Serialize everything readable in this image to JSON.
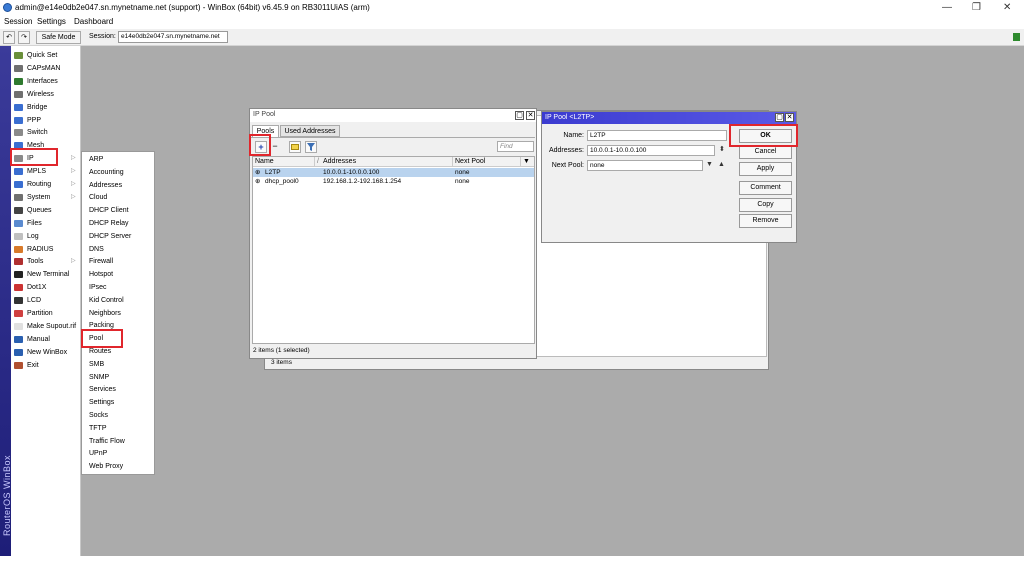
{
  "window": {
    "title": "admin@e14e0db2e047.sn.mynetname.net (support) - WinBox (64bit) v6.45.9 on RB3011UiAS (arm)",
    "controls": {
      "minimize": "—",
      "maximize": "❐",
      "close": "✕"
    }
  },
  "menubar": [
    "Session",
    "Settings",
    "Dashboard"
  ],
  "toolbar": {
    "undo": "↶",
    "redo": "↷",
    "safe_mode": "Safe Mode",
    "session_label": "Session:",
    "session_value": "e14e0db2e047.sn.mynetname.net"
  },
  "sidebar": {
    "brand": "RouterOS WinBox",
    "items": [
      {
        "label": "Quick Set",
        "icon": "quickset-icon",
        "color": "#6a8f3a"
      },
      {
        "label": "CAPsMAN",
        "icon": "antenna-icon",
        "color": "#707070"
      },
      {
        "label": "Interfaces",
        "icon": "interfaces-icon",
        "color": "#2f7a2f"
      },
      {
        "label": "Wireless",
        "icon": "antenna-icon",
        "color": "#707070"
      },
      {
        "label": "Bridge",
        "icon": "bridge-icon",
        "color": "#3a6ed1"
      },
      {
        "label": "PPP",
        "icon": "ppp-icon",
        "color": "#3a6ed1"
      },
      {
        "label": "Switch",
        "icon": "switch-icon",
        "color": "#8a8a8a"
      },
      {
        "label": "Mesh",
        "icon": "mesh-icon",
        "color": "#3a6ed1"
      },
      {
        "label": "IP",
        "icon": "ip-icon",
        "color": "#8a8a8a",
        "arrow": "▷"
      },
      {
        "label": "MPLS",
        "icon": "mpls-icon",
        "color": "#3a6ed1",
        "arrow": "▷"
      },
      {
        "label": "Routing",
        "icon": "routing-icon",
        "color": "#3a6ed1",
        "arrow": "▷"
      },
      {
        "label": "System",
        "icon": "gear-icon",
        "color": "#707070",
        "arrow": "▷"
      },
      {
        "label": "Queues",
        "icon": "queues-icon",
        "color": "#444444"
      },
      {
        "label": "Files",
        "icon": "files-icon",
        "color": "#5b8bd0"
      },
      {
        "label": "Log",
        "icon": "log-icon",
        "color": "#c0c0c0"
      },
      {
        "label": "RADIUS",
        "icon": "radius-icon",
        "color": "#d87a2a"
      },
      {
        "label": "Tools",
        "icon": "tools-icon",
        "color": "#b03030",
        "arrow": "▷"
      },
      {
        "label": "New Terminal",
        "icon": "terminal-icon",
        "color": "#222222"
      },
      {
        "label": "Dot1X",
        "icon": "dot1x-icon",
        "color": "#cc3333"
      },
      {
        "label": "LCD",
        "icon": "lcd-icon",
        "color": "#333333"
      },
      {
        "label": "Partition",
        "icon": "partition-icon",
        "color": "#d04040"
      },
      {
        "label": "Make Supout.rif",
        "icon": "supout-icon",
        "color": "#e0e0e0"
      },
      {
        "label": "Manual",
        "icon": "manual-icon",
        "color": "#2a5fb0"
      },
      {
        "label": "New WinBox",
        "icon": "winbox-icon",
        "color": "#2a5fb0"
      },
      {
        "label": "Exit",
        "icon": "exit-icon",
        "color": "#b05030"
      }
    ]
  },
  "ip_submenu": [
    "ARP",
    "Accounting",
    "Addresses",
    "Cloud",
    "DHCP Client",
    "DHCP Relay",
    "DHCP Server",
    "DNS",
    "Firewall",
    "Hotspot",
    "IPsec",
    "Kid Control",
    "Neighbors",
    "Packing",
    "Pool",
    "Routes",
    "SMB",
    "SNMP",
    "Services",
    "Settings",
    "Socks",
    "TFTP",
    "Traffic Flow",
    "UPnP",
    "Web Proxy"
  ],
  "background_window": {
    "status": "3 items"
  },
  "ip_pool": {
    "title": "IP Pool",
    "tabs": [
      "Pools",
      "Used Addresses"
    ],
    "toolbar": {
      "add": "+",
      "remove": "−",
      "find_placeholder": "Find"
    },
    "columns": [
      "Name",
      "/",
      "Addresses",
      "Next Pool"
    ],
    "rows": [
      {
        "name": "L2TP",
        "addresses": "10.0.0.1-10.0.0.100",
        "next_pool": "none"
      },
      {
        "name": "dhcp_pool0",
        "addresses": "192.168.1.2-192.168.1.254",
        "next_pool": "none"
      }
    ],
    "status": "2 items (1 selected)"
  },
  "pool_dialog": {
    "title": "IP Pool <L2TP>",
    "name_label": "Name:",
    "name_value": "L2TP",
    "addresses_label": "Addresses:",
    "addresses_value": "10.0.0.1-10.0.0.100",
    "next_pool_label": "Next Pool:",
    "next_pool_value": "none",
    "buttons": {
      "ok": "OK",
      "cancel": "Cancel",
      "apply": "Apply",
      "comment": "Comment",
      "copy": "Copy",
      "remove": "Remove"
    }
  }
}
